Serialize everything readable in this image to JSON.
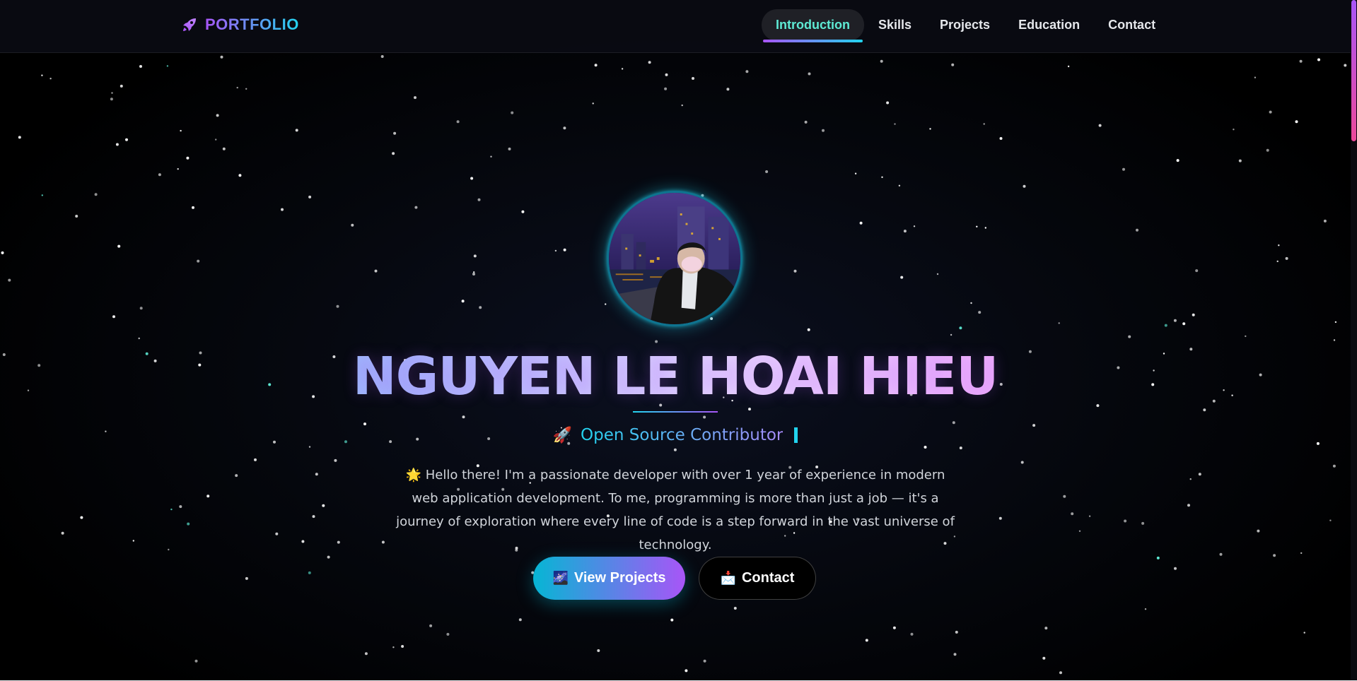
{
  "brand": {
    "name": "PORTFOLIO",
    "icon": "rocket-icon"
  },
  "nav": {
    "items": [
      {
        "label": "Introduction",
        "active": true
      },
      {
        "label": "Skills",
        "active": false
      },
      {
        "label": "Projects",
        "active": false
      },
      {
        "label": "Education",
        "active": false
      },
      {
        "label": "Contact",
        "active": false
      }
    ]
  },
  "hero": {
    "name": "NGUYEN LE HOAI HIEU",
    "role_emoji": "🚀",
    "role": "Open Source Contributor",
    "intro_emoji": "🌟",
    "intro": "Hello there! I'm a passionate developer with over 1 year of experience in modern web application development. To me, programming is more than just a job — it's a journey of exploration where every line of code is a step forward in the vast universe of technology.",
    "primary_button": {
      "icon": "🌌",
      "label": "View Projects"
    },
    "secondary_button": {
      "icon": "📩",
      "label": "Contact"
    }
  },
  "colors": {
    "accent_cyan": "#22d3ee",
    "accent_purple": "#a855f7",
    "accent_pink": "#f9a8d4",
    "background": "#000000"
  }
}
